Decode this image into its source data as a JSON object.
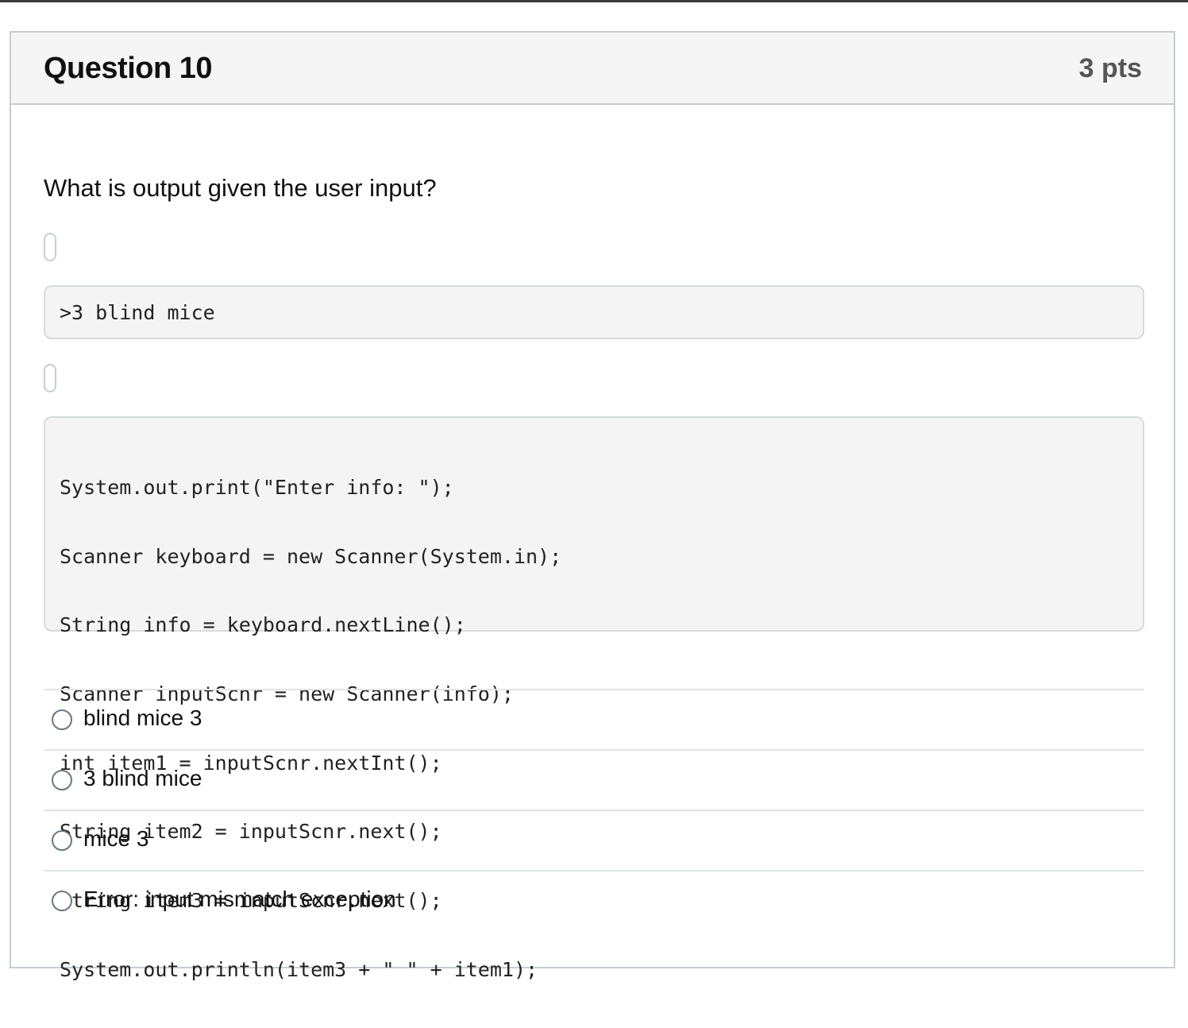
{
  "question": {
    "title": "Question 10",
    "points": "3 pts",
    "prompt": "What is output given the user input?",
    "user_input": ">3 blind mice",
    "code_lines": [
      "System.out.print(\"Enter info: \");",
      "Scanner keyboard = new Scanner(System.in);",
      "String info = keyboard.nextLine();",
      "Scanner inputScnr = new Scanner(info);",
      "int item1 = inputScnr.nextInt();",
      "String item2 = inputScnr.next();",
      "String item3 = inputScnr.next();",
      "System.out.println(item3 + \" \" + item1);"
    ]
  },
  "answers": [
    {
      "label": "blind mice 3"
    },
    {
      "label": "3 blind mice"
    },
    {
      "label": "mice 3"
    },
    {
      "label": "Error: input mismatch exception"
    }
  ]
}
